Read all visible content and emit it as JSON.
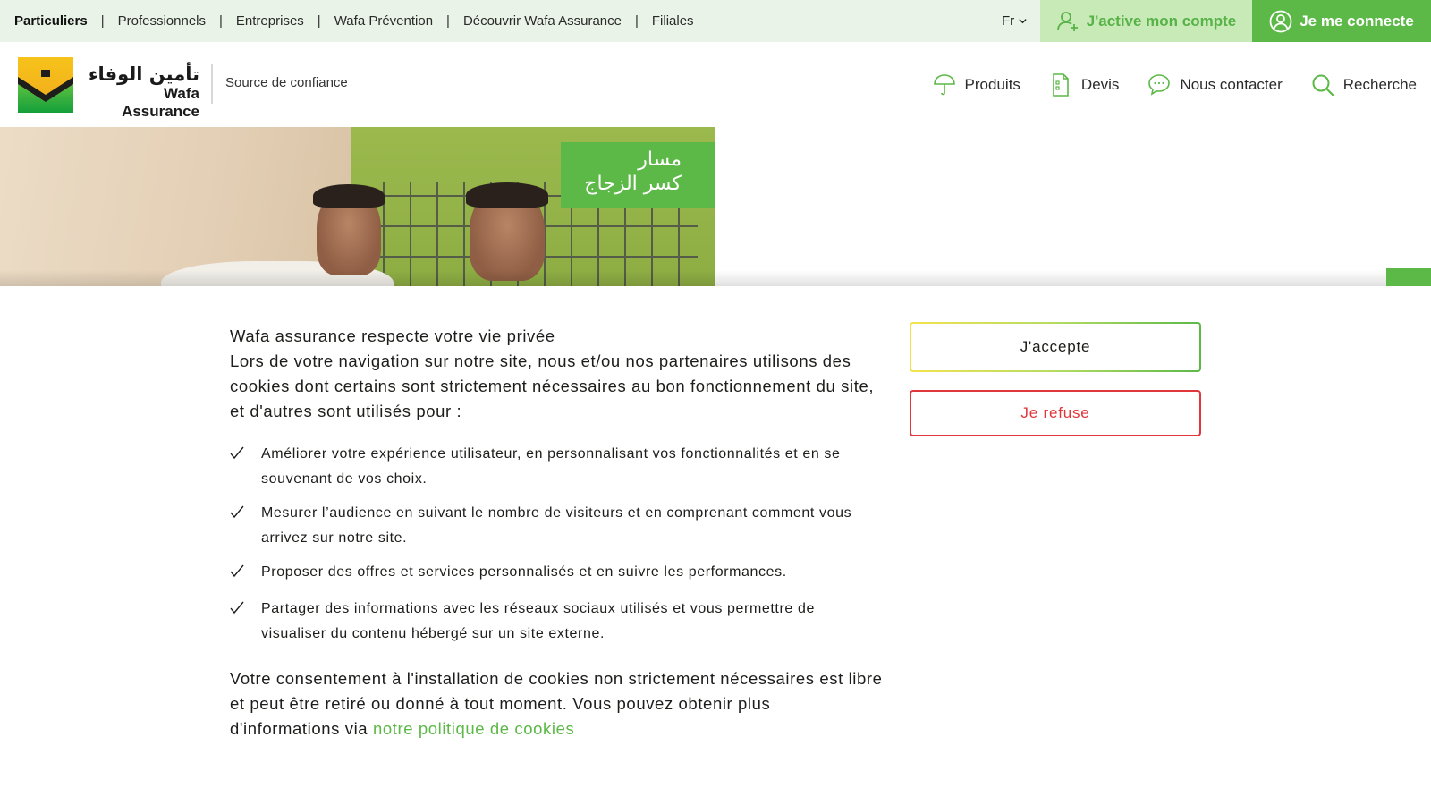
{
  "topbar": {
    "segments": [
      "Particuliers",
      "Professionnels",
      "Entreprises",
      "Wafa Prévention",
      "Découvrir Wafa Assurance",
      "Filiales"
    ],
    "separator": "|",
    "language": "Fr",
    "activate_label": "J'active mon compte",
    "connect_label": "Je me connecte"
  },
  "header": {
    "logo_arabic": "تأمين الوفاء",
    "logo_latin": "Wafa Assurance",
    "tagline": "Source de confiance",
    "nav": [
      {
        "label": "Produits",
        "icon": "umbrella-icon"
      },
      {
        "label": "Devis",
        "icon": "document-icon"
      },
      {
        "label": "Nous contacter",
        "icon": "chat-bubble-icon"
      },
      {
        "label": "Recherche",
        "icon": "search-icon"
      }
    ]
  },
  "hero": {
    "badge_line1": "مسار",
    "badge_line2": "كسر الزجاج"
  },
  "cookie": {
    "title": "Wafa assurance respecte votre vie privée",
    "intro": "Lors de votre navigation sur notre site, nous et/ou nos partenaires utilisons des cookies dont certains sont strictement nécessaires au bon fonctionnement du site, et d'autres sont utilisés pour :",
    "items": [
      "Améliorer votre expérience utilisateur, en personnalisant vos fonctionnalités et en se souvenant de vos choix.",
      "Mesurer l’audience en suivant le nombre de visiteurs et en comprenant comment vous arrivez sur notre site.",
      "Proposer des offres et services personnalisés et en suivre les performances.",
      "Partager des informations avec les réseaux sociaux utilisés et vous permettre de visualiser du contenu hébergé sur un site externe."
    ],
    "consent_text": "Votre consentement à l'installation de cookies non strictement nécessaires est libre et peut être retiré ou donné à tout moment. Vous pouvez obtenir plus d'informations via",
    "policy_link": "notre politique de cookies",
    "accept_label": "J'accepte",
    "refuse_label": "Je refuse"
  },
  "colors": {
    "brand_green": "#5cb847",
    "topbar_bg": "#e9f3e7",
    "activate_bg": "#c8eab6",
    "refuse_red": "#e0373c"
  }
}
